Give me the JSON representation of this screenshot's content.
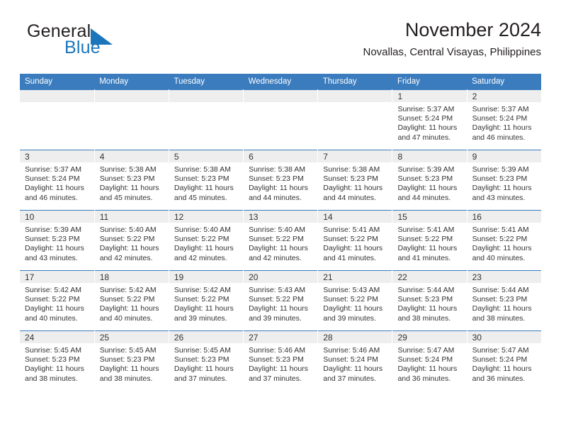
{
  "brand": {
    "name_top": "General",
    "name_bottom": "Blue",
    "triangle_color": "#1b75bb",
    "text_color": "#231f20"
  },
  "header": {
    "title": "November 2024",
    "subtitle": "Novallas, Central Visayas, Philippines"
  },
  "theme": {
    "header_bar": "#3a7cbe",
    "daynum_strip": "#eeeeee",
    "text": "#333333"
  },
  "weekday_headers": [
    "Sunday",
    "Monday",
    "Tuesday",
    "Wednesday",
    "Thursday",
    "Friday",
    "Saturday"
  ],
  "weeks": [
    [
      {
        "day": "",
        "empty": true
      },
      {
        "day": "",
        "empty": true
      },
      {
        "day": "",
        "empty": true
      },
      {
        "day": "",
        "empty": true
      },
      {
        "day": "",
        "empty": true
      },
      {
        "day": "1",
        "sunrise": "Sunrise: 5:37 AM",
        "sunset": "Sunset: 5:24 PM",
        "daylight1": "Daylight: 11 hours",
        "daylight2": "and 47 minutes."
      },
      {
        "day": "2",
        "sunrise": "Sunrise: 5:37 AM",
        "sunset": "Sunset: 5:24 PM",
        "daylight1": "Daylight: 11 hours",
        "daylight2": "and 46 minutes."
      }
    ],
    [
      {
        "day": "3",
        "sunrise": "Sunrise: 5:37 AM",
        "sunset": "Sunset: 5:24 PM",
        "daylight1": "Daylight: 11 hours",
        "daylight2": "and 46 minutes."
      },
      {
        "day": "4",
        "sunrise": "Sunrise: 5:38 AM",
        "sunset": "Sunset: 5:23 PM",
        "daylight1": "Daylight: 11 hours",
        "daylight2": "and 45 minutes."
      },
      {
        "day": "5",
        "sunrise": "Sunrise: 5:38 AM",
        "sunset": "Sunset: 5:23 PM",
        "daylight1": "Daylight: 11 hours",
        "daylight2": "and 45 minutes."
      },
      {
        "day": "6",
        "sunrise": "Sunrise: 5:38 AM",
        "sunset": "Sunset: 5:23 PM",
        "daylight1": "Daylight: 11 hours",
        "daylight2": "and 44 minutes."
      },
      {
        "day": "7",
        "sunrise": "Sunrise: 5:38 AM",
        "sunset": "Sunset: 5:23 PM",
        "daylight1": "Daylight: 11 hours",
        "daylight2": "and 44 minutes."
      },
      {
        "day": "8",
        "sunrise": "Sunrise: 5:39 AM",
        "sunset": "Sunset: 5:23 PM",
        "daylight1": "Daylight: 11 hours",
        "daylight2": "and 44 minutes."
      },
      {
        "day": "9",
        "sunrise": "Sunrise: 5:39 AM",
        "sunset": "Sunset: 5:23 PM",
        "daylight1": "Daylight: 11 hours",
        "daylight2": "and 43 minutes."
      }
    ],
    [
      {
        "day": "10",
        "sunrise": "Sunrise: 5:39 AM",
        "sunset": "Sunset: 5:23 PM",
        "daylight1": "Daylight: 11 hours",
        "daylight2": "and 43 minutes."
      },
      {
        "day": "11",
        "sunrise": "Sunrise: 5:40 AM",
        "sunset": "Sunset: 5:22 PM",
        "daylight1": "Daylight: 11 hours",
        "daylight2": "and 42 minutes."
      },
      {
        "day": "12",
        "sunrise": "Sunrise: 5:40 AM",
        "sunset": "Sunset: 5:22 PM",
        "daylight1": "Daylight: 11 hours",
        "daylight2": "and 42 minutes."
      },
      {
        "day": "13",
        "sunrise": "Sunrise: 5:40 AM",
        "sunset": "Sunset: 5:22 PM",
        "daylight1": "Daylight: 11 hours",
        "daylight2": "and 42 minutes."
      },
      {
        "day": "14",
        "sunrise": "Sunrise: 5:41 AM",
        "sunset": "Sunset: 5:22 PM",
        "daylight1": "Daylight: 11 hours",
        "daylight2": "and 41 minutes."
      },
      {
        "day": "15",
        "sunrise": "Sunrise: 5:41 AM",
        "sunset": "Sunset: 5:22 PM",
        "daylight1": "Daylight: 11 hours",
        "daylight2": "and 41 minutes."
      },
      {
        "day": "16",
        "sunrise": "Sunrise: 5:41 AM",
        "sunset": "Sunset: 5:22 PM",
        "daylight1": "Daylight: 11 hours",
        "daylight2": "and 40 minutes."
      }
    ],
    [
      {
        "day": "17",
        "sunrise": "Sunrise: 5:42 AM",
        "sunset": "Sunset: 5:22 PM",
        "daylight1": "Daylight: 11 hours",
        "daylight2": "and 40 minutes."
      },
      {
        "day": "18",
        "sunrise": "Sunrise: 5:42 AM",
        "sunset": "Sunset: 5:22 PM",
        "daylight1": "Daylight: 11 hours",
        "daylight2": "and 40 minutes."
      },
      {
        "day": "19",
        "sunrise": "Sunrise: 5:42 AM",
        "sunset": "Sunset: 5:22 PM",
        "daylight1": "Daylight: 11 hours",
        "daylight2": "and 39 minutes."
      },
      {
        "day": "20",
        "sunrise": "Sunrise: 5:43 AM",
        "sunset": "Sunset: 5:22 PM",
        "daylight1": "Daylight: 11 hours",
        "daylight2": "and 39 minutes."
      },
      {
        "day": "21",
        "sunrise": "Sunrise: 5:43 AM",
        "sunset": "Sunset: 5:22 PM",
        "daylight1": "Daylight: 11 hours",
        "daylight2": "and 39 minutes."
      },
      {
        "day": "22",
        "sunrise": "Sunrise: 5:44 AM",
        "sunset": "Sunset: 5:23 PM",
        "daylight1": "Daylight: 11 hours",
        "daylight2": "and 38 minutes."
      },
      {
        "day": "23",
        "sunrise": "Sunrise: 5:44 AM",
        "sunset": "Sunset: 5:23 PM",
        "daylight1": "Daylight: 11 hours",
        "daylight2": "and 38 minutes."
      }
    ],
    [
      {
        "day": "24",
        "sunrise": "Sunrise: 5:45 AM",
        "sunset": "Sunset: 5:23 PM",
        "daylight1": "Daylight: 11 hours",
        "daylight2": "and 38 minutes."
      },
      {
        "day": "25",
        "sunrise": "Sunrise: 5:45 AM",
        "sunset": "Sunset: 5:23 PM",
        "daylight1": "Daylight: 11 hours",
        "daylight2": "and 38 minutes."
      },
      {
        "day": "26",
        "sunrise": "Sunrise: 5:45 AM",
        "sunset": "Sunset: 5:23 PM",
        "daylight1": "Daylight: 11 hours",
        "daylight2": "and 37 minutes."
      },
      {
        "day": "27",
        "sunrise": "Sunrise: 5:46 AM",
        "sunset": "Sunset: 5:23 PM",
        "daylight1": "Daylight: 11 hours",
        "daylight2": "and 37 minutes."
      },
      {
        "day": "28",
        "sunrise": "Sunrise: 5:46 AM",
        "sunset": "Sunset: 5:24 PM",
        "daylight1": "Daylight: 11 hours",
        "daylight2": "and 37 minutes."
      },
      {
        "day": "29",
        "sunrise": "Sunrise: 5:47 AM",
        "sunset": "Sunset: 5:24 PM",
        "daylight1": "Daylight: 11 hours",
        "daylight2": "and 36 minutes."
      },
      {
        "day": "30",
        "sunrise": "Sunrise: 5:47 AM",
        "sunset": "Sunset: 5:24 PM",
        "daylight1": "Daylight: 11 hours",
        "daylight2": "and 36 minutes."
      }
    ]
  ]
}
